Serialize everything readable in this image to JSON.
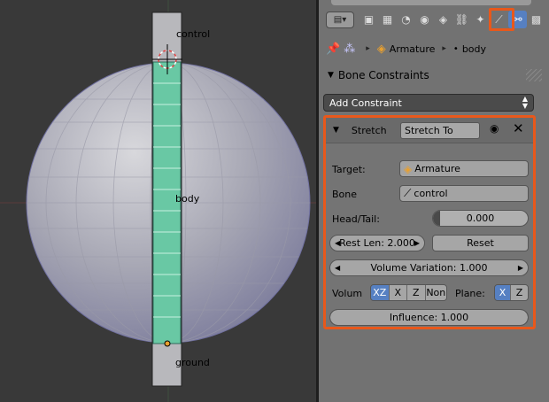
{
  "viewport": {
    "labels": {
      "control": "control",
      "body": "body",
      "ground": "ground"
    }
  },
  "tabs": {
    "items": [
      {
        "icon": "render-icon",
        "glyph": "▣"
      },
      {
        "icon": "render-layers-icon",
        "glyph": "▦"
      },
      {
        "icon": "scene-icon",
        "glyph": "◔"
      },
      {
        "icon": "world-icon",
        "glyph": "◉"
      },
      {
        "icon": "object-icon",
        "glyph": "◈"
      },
      {
        "icon": "object-constraints-icon",
        "glyph": "⛓"
      },
      {
        "icon": "object-data-icon",
        "glyph": "✦"
      },
      {
        "icon": "bone-icon",
        "glyph": "⟋"
      },
      {
        "icon": "bone-constraints-icon",
        "glyph": "⚯"
      },
      {
        "icon": "texture-icon",
        "glyph": "▩"
      },
      {
        "icon": "more-icon",
        "glyph": "▾"
      }
    ],
    "active_index": 8
  },
  "breadcrumb": {
    "object": "Armature",
    "bone": "body"
  },
  "panel": {
    "title": "Bone Constraints",
    "add_constraint": "Add Constraint"
  },
  "constraint": {
    "type_label": "Stretch",
    "name": "Stretch To",
    "target_label": "Target:",
    "target_value": "Armature",
    "bone_label": "Bone",
    "bone_value": "control",
    "headtail_label": "Head/Tail:",
    "headtail_value": "0.000",
    "rest_len": "Rest Len: 2.000",
    "reset": "Reset",
    "volume_variation": "Volume Variation: 1.000",
    "volume_label": "Volum",
    "volume_options": [
      "XZ",
      "X",
      "Z",
      "Non"
    ],
    "volume_selected": 0,
    "plane_label": "Plane:",
    "plane_options": [
      "X",
      "Z"
    ],
    "plane_selected": 0,
    "influence": "Influence: 1.000"
  },
  "colors": {
    "highlight": "#e8581b",
    "active_blue": "#5680c2",
    "bone_green": "#69c8a4"
  }
}
